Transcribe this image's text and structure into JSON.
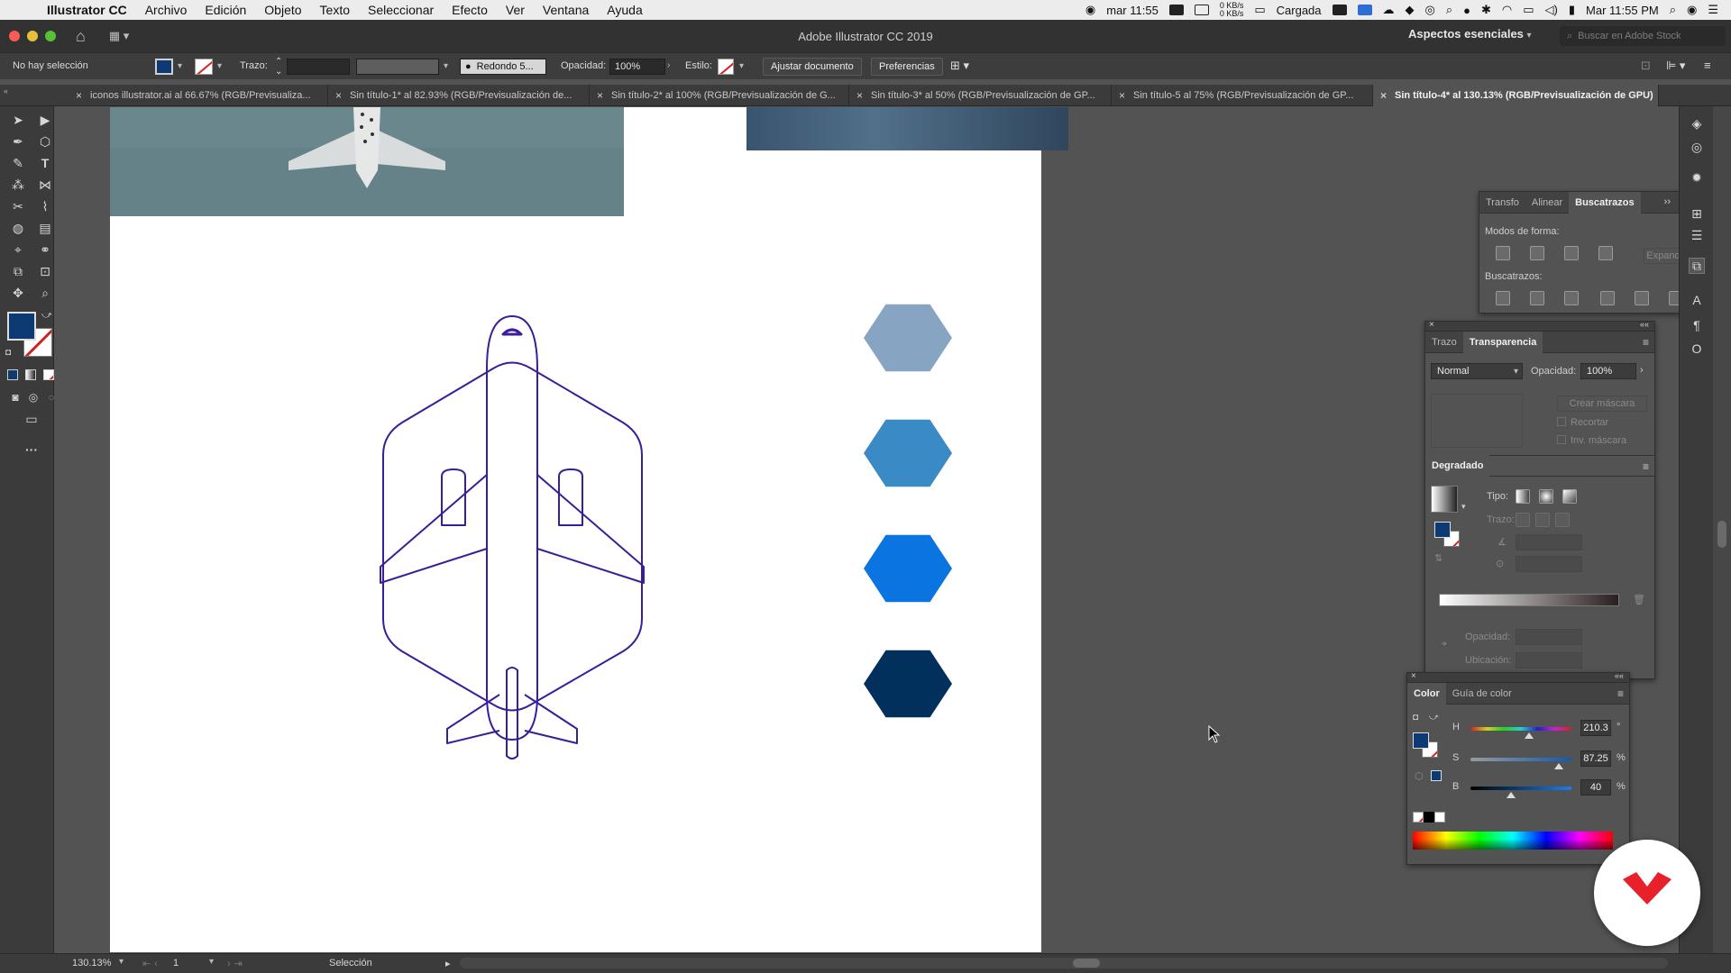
{
  "menubar": {
    "app_name": "Illustrator CC",
    "items": [
      "Archivo",
      "Edición",
      "Objeto",
      "Texto",
      "Seleccionar",
      "Efecto",
      "Ver",
      "Ventana",
      "Ayuda"
    ],
    "status": {
      "clock_short": "mar 11:55",
      "net_up": "0 KB/s",
      "net_down": "0 KB/s",
      "battery_label": "Cargada",
      "clock_long": "Mar 11:55 PM"
    }
  },
  "window": {
    "title": "Adobe Illustrator CC 2019",
    "workspace": "Aspectos esenciales",
    "stock_placeholder": "Buscar en Adobe Stock"
  },
  "controlbar": {
    "selection_status": "No hay selección",
    "stroke_label": "Trazo:",
    "brush_value": "Redondo 5...",
    "opacity_label": "Opacidad:",
    "opacity_value": "100%",
    "style_label": "Estilo:",
    "fit_document": "Ajustar documento",
    "preferences": "Preferencias",
    "fill_color": "#0e3a73"
  },
  "tabs": [
    {
      "label": "iconos illustrator.ai al 66.67% (RGB/Previsualiza..."
    },
    {
      "label": "Sin título-1* al 82.93% (RGB/Previsualización de..."
    },
    {
      "label": "Sin título-2* al 100% (RGB/Previsualización de G..."
    },
    {
      "label": "Sin título-3* al 50% (RGB/Previsualización de GP..."
    },
    {
      "label": "Sin título-5 al 75% (RGB/Previsualización de GP..."
    },
    {
      "label": "Sin título-4* al 130.13% (RGB/Previsualización de GPU)"
    }
  ],
  "artwork": {
    "stroke_color": "#3a1d98",
    "hexagons": [
      {
        "name": "hexagon-light-steel",
        "color": "#87a5c2"
      },
      {
        "name": "hexagon-medium-blue",
        "color": "#3a8ac6"
      },
      {
        "name": "hexagon-bright-blue",
        "color": "#0a74e0"
      },
      {
        "name": "hexagon-navy",
        "color": "#02305d"
      }
    ]
  },
  "pathfinder": {
    "tabs": [
      "Transfo",
      "Alinear",
      "Buscatrazos"
    ],
    "shape_modes_label": "Modos de forma:",
    "expand_label": "Expandir",
    "pathfinders_label": "Buscatrazos:"
  },
  "transparency": {
    "tabs": [
      "Trazo",
      "Transparencia"
    ],
    "blend_mode": "Normal",
    "opacity_label": "Opacidad:",
    "opacity_value": "100%",
    "make_mask": "Crear máscara",
    "clip": "Recortar",
    "invert_mask": "Inv. máscara"
  },
  "gradient": {
    "tab": "Degradado",
    "type_label": "Tipo:",
    "stroke_label": "Trazo:",
    "opacity_label": "Opacidad:",
    "location_label": "Ubicación:"
  },
  "color": {
    "tabs": [
      "Color",
      "Guía de color"
    ],
    "channels": [
      {
        "label": "H",
        "value": "210.3",
        "unit": "°",
        "level": 0.584
      },
      {
        "label": "S",
        "value": "87.25",
        "unit": "%",
        "level": 0.8725
      },
      {
        "label": "B",
        "value": "40",
        "unit": "%",
        "level": 0.4
      }
    ],
    "fill_color": "#0e3a73"
  },
  "statusbar": {
    "zoom": "130.13%",
    "artboard_number": "1",
    "tool_name": "Selección"
  }
}
